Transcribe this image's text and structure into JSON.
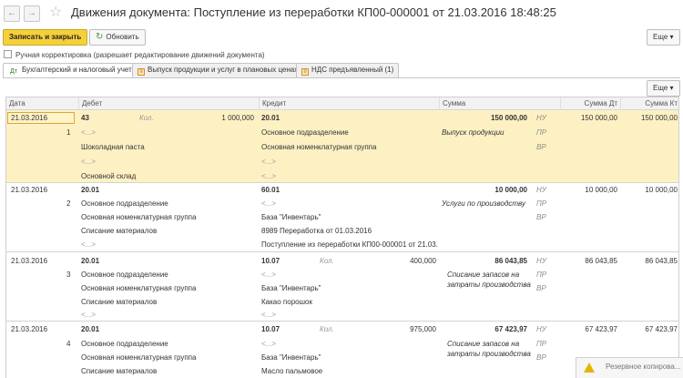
{
  "window": {
    "title": "Движения документа: Поступление из переработки КП00-000001 от 21.03.2016 18:48:25",
    "back_glyph": "←",
    "forward_glyph": "→",
    "star_glyph": "☆"
  },
  "toolbar": {
    "save_close_label": "Записать и закрыть",
    "refresh_label": "Обновить",
    "refresh_glyph": "↻",
    "more_label": "Еще",
    "more_glyph": "▾"
  },
  "manual_checkbox": {
    "label": "Ручная корректировка (разрешает редактирование движений документа)",
    "checked": false
  },
  "tabs": [
    {
      "label": "Бухгалтерский и налоговый учет (6)",
      "icon": "dt-kt-icon",
      "glyph": "Дт"
    },
    {
      "label": "Выпуск продукции и услуг в плановых ценах (1)",
      "icon": "register-icon",
      "glyph": "≡"
    },
    {
      "label": "НДС предъявленный (1)",
      "icon": "register-icon",
      "glyph": "≡"
    }
  ],
  "grid_toolbar": {
    "more_label": "Еще",
    "more_glyph": "▾"
  },
  "columns": {
    "date": "Дата",
    "debit": "Дебет",
    "credit": "Кредит",
    "sum": "Сумма",
    "sum_dt": "Сумма Дт",
    "sum_kt": "Сумма Кт"
  },
  "records": [
    {
      "date": "21.03.2016",
      "num": "1",
      "dt_account": "43",
      "dt_qty_label": "Кол.",
      "dt_qty": "1 000,000",
      "kt_account": "20.01",
      "kt_qty_label": "",
      "kt_qty": "",
      "sum": "150 000,00",
      "content": "Выпуск продукции",
      "sum_dt": "150 000,00",
      "sum_kt": "150 000,00",
      "dt_sub": [
        "<...>",
        "Шоколадная паста",
        "<...>",
        "Основной склад"
      ],
      "kt_sub": [
        "Основное подразделение",
        "Основная номенклатурная группа",
        "<...>",
        "<...>"
      ]
    },
    {
      "date": "21.03.2016",
      "num": "2",
      "dt_account": "20.01",
      "dt_qty_label": "",
      "dt_qty": "",
      "kt_account": "60.01",
      "kt_qty_label": "",
      "kt_qty": "",
      "sum": "10 000,00",
      "content": "Услуги по производству",
      "sum_dt": "10 000,00",
      "sum_kt": "10 000,00",
      "dt_sub": [
        "Основное подразделение",
        "Основная номенклатурная группа",
        "Списание материалов",
        "<...>"
      ],
      "kt_sub": [
        "<...>",
        "База \"Инвентарь\"",
        "8989 Переработка от 01.03.2016",
        "Поступление из переработки КП00-000001 от 21.03.2..."
      ]
    },
    {
      "date": "21.03.2016",
      "num": "3",
      "dt_account": "20.01",
      "dt_qty_label": "",
      "dt_qty": "",
      "kt_account": "10.07",
      "kt_qty_label": "Кол.",
      "kt_qty": "400,000",
      "sum": "86 043,85",
      "content": "Списание запасов на затраты производства",
      "sum_dt": "86 043,85",
      "sum_kt": "86 043,85",
      "dt_sub": [
        "Основное подразделение",
        "Основная номенклатурная группа",
        "Списание материалов",
        "<...>"
      ],
      "kt_sub": [
        "<...>",
        "База \"Инвентарь\"",
        "Какао порошок",
        "<...>"
      ]
    },
    {
      "date": "21.03.2016",
      "num": "4",
      "dt_account": "20.01",
      "dt_qty_label": "",
      "dt_qty": "",
      "kt_account": "10.07",
      "kt_qty_label": "Кол.",
      "kt_qty": "975,000",
      "sum": "67 423,97",
      "content": "Списание запасов на затраты производства",
      "sum_dt": "67 423,97",
      "sum_kt": "67 423,97",
      "dt_sub": [
        "Основное подразделение",
        "Основная номенклатурная группа",
        "Списание материалов",
        ""
      ],
      "kt_sub": [
        "<...>",
        "База \"Инвентарь\"",
        "Масло пальмовое",
        ""
      ]
    }
  ],
  "accounting_labels": [
    "НУ",
    "ПР",
    "ВР"
  ],
  "notification": {
    "text": "Резервное копирова..."
  },
  "colors": {
    "selected_row": "#fdf1c4",
    "primary_button": "#f5d03a",
    "accent": "#d9a83a"
  }
}
